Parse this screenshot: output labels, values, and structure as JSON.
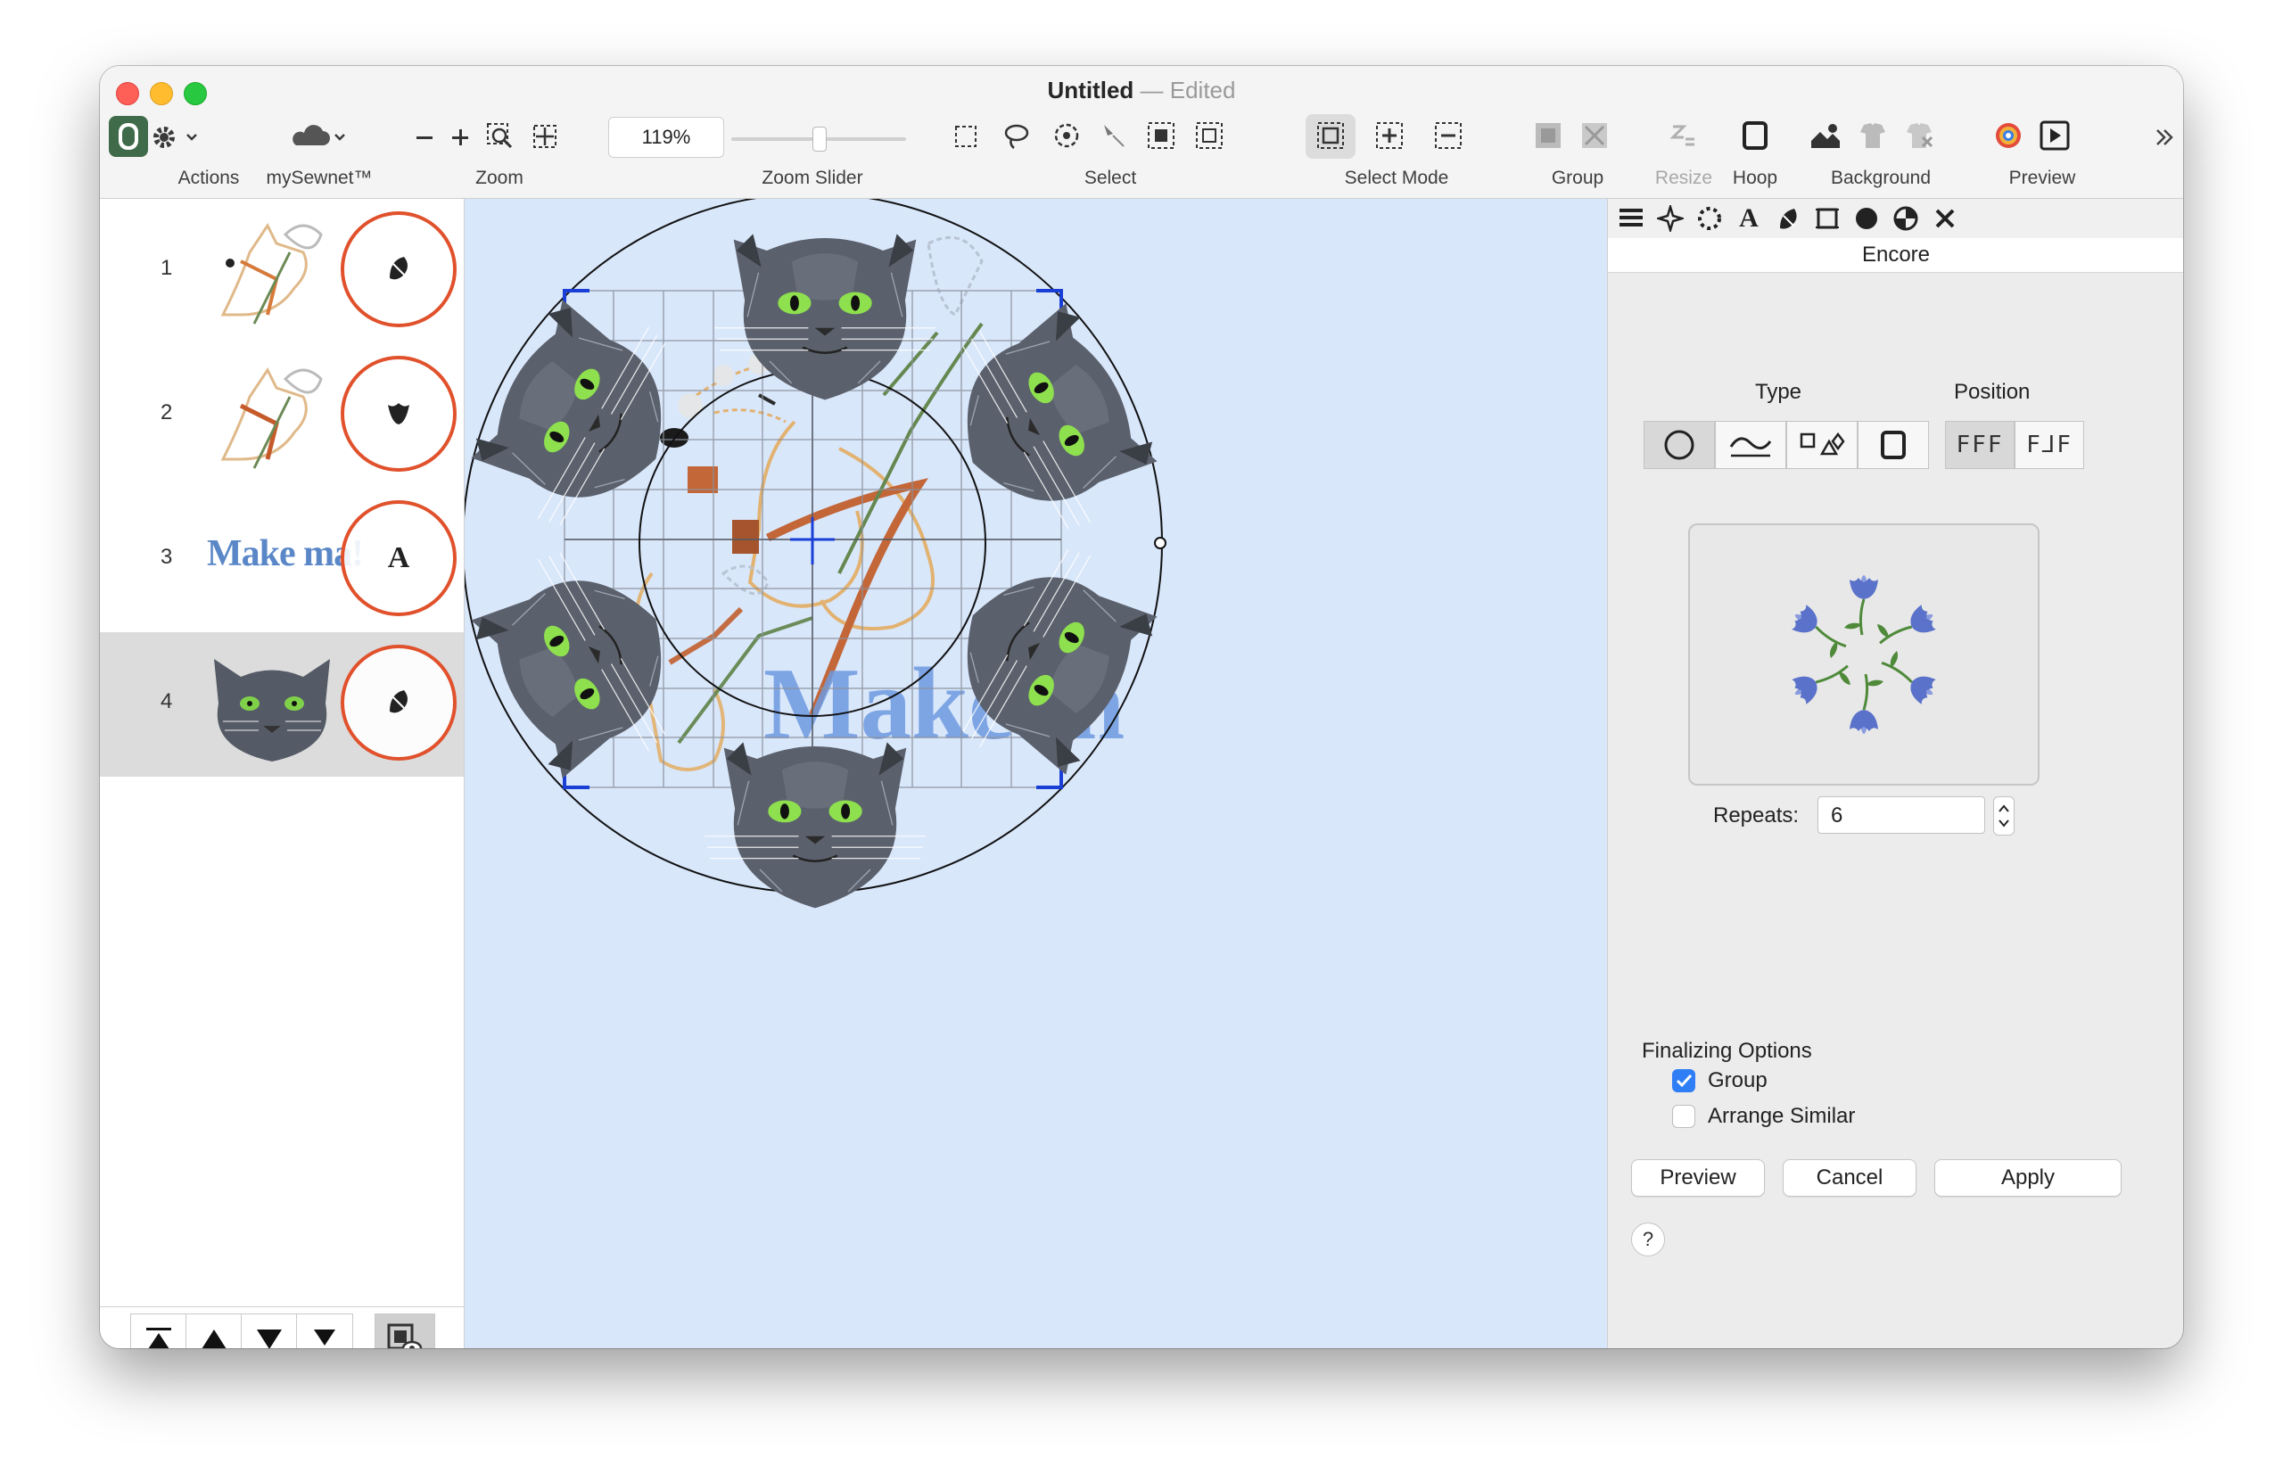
{
  "window": {
    "title": "Untitled",
    "separator": "—",
    "status": "Edited"
  },
  "toolbar": {
    "labels": {
      "actions": "Actions",
      "mysewnet": "mySewnet™",
      "zoom": "Zoom",
      "zoom_slider": "Zoom Slider",
      "select": "Select",
      "select_mode": "Select Mode",
      "group": "Group",
      "resize": "Resize",
      "hoop": "Hoop",
      "background": "Background",
      "preview": "Preview"
    },
    "zoom_value": "119%",
    "zoom_slider_value": 0.5,
    "overflow_icon": "chevron-double-right-icon"
  },
  "layers": {
    "items": [
      {
        "number": "1",
        "thumbnail": "fox-with-flower",
        "type_icon": "embroidery-icon"
      },
      {
        "number": "2",
        "thumbnail": "fox-with-flower",
        "type_icon": "tulip-icon"
      },
      {
        "number": "3",
        "thumbnail_text": "Make ma!",
        "type_icon_text": "A"
      },
      {
        "number": "4",
        "thumbnail": "grey-cat-face",
        "type_icon": "embroidery-icon",
        "selected": true
      }
    ],
    "help_label": "?"
  },
  "canvas": {
    "text_on_canvas": "Make m",
    "background": "#d9e7fb"
  },
  "panel": {
    "title": "Encore",
    "type_label": "Type",
    "position_label": "Position",
    "position_options": [
      "FFF",
      "F⅃F"
    ],
    "repeats_label": "Repeats:",
    "repeats_value": "6",
    "finalizing_label": "Finalizing Options",
    "group_label": "Group",
    "group_checked": true,
    "arrange_label": "Arrange Similar",
    "arrange_checked": false,
    "preview_button": "Preview",
    "cancel_button": "Cancel",
    "apply_button": "Apply",
    "help_label": "?"
  },
  "colors": {
    "accent": "#2f7ef5",
    "layer_ring": "#e0512c",
    "selection_marker": "#1a3fd6"
  }
}
